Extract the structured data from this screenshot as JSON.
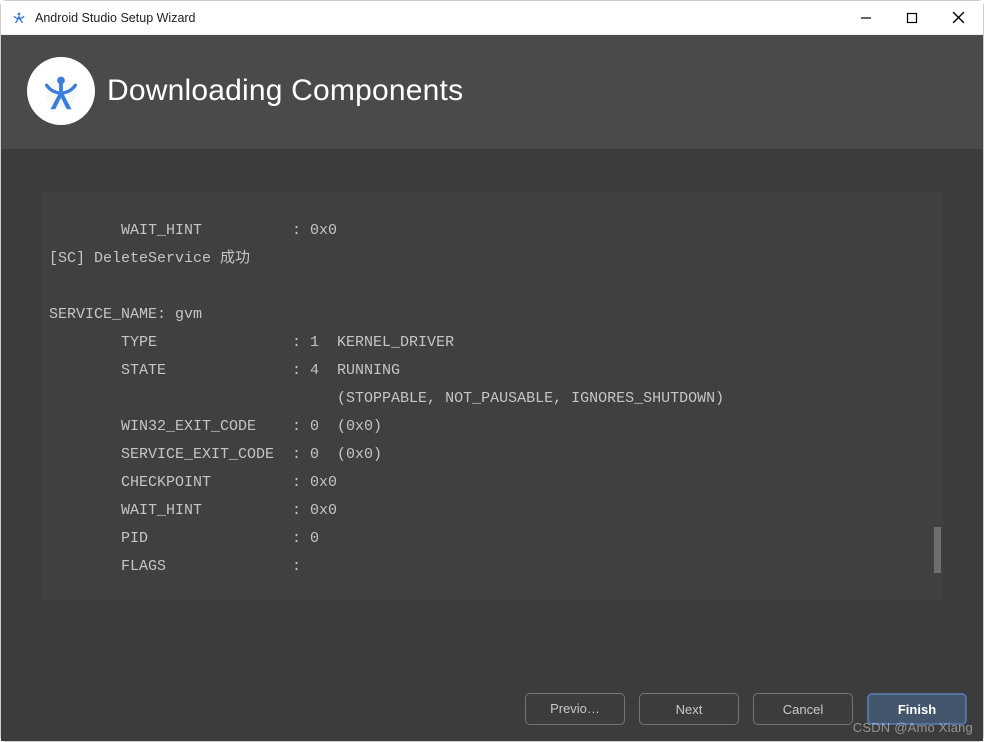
{
  "titlebar": {
    "title": "Android Studio Setup Wizard"
  },
  "header": {
    "title": "Downloading Components"
  },
  "console": {
    "lines": [
      "        WAIT_HINT          : 0x0",
      "[SC] DeleteService 成功",
      "",
      "SERVICE_NAME: gvm",
      "        TYPE               : 1  KERNEL_DRIVER",
      "        STATE              : 4  RUNNING",
      "                                (STOPPABLE, NOT_PAUSABLE, IGNORES_SHUTDOWN)",
      "        WIN32_EXIT_CODE    : 0  (0x0)",
      "        SERVICE_EXIT_CODE  : 0  (0x0)",
      "        CHECKPOINT         : 0x0",
      "        WAIT_HINT          : 0x0",
      "        PID                : 0",
      "        FLAGS              :"
    ]
  },
  "footer": {
    "previous": "Previo…",
    "next": "Next",
    "cancel": "Cancel",
    "finish": "Finish"
  },
  "watermark": "CSDN @Amo Xiang"
}
